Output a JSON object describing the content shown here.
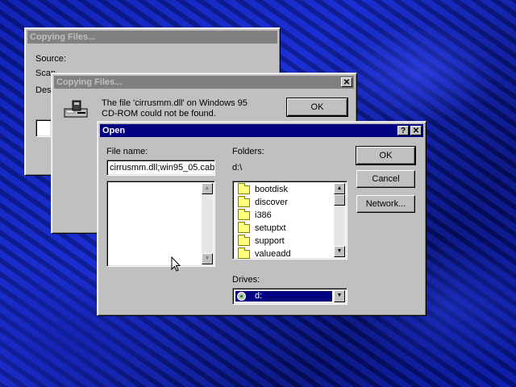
{
  "background_window": {
    "title": "Copying Files...",
    "source_label": "Source:",
    "scanning_label": "Scan",
    "dest_label": "Des"
  },
  "error_dialog": {
    "title": "Copying Files...",
    "message_line1": "The file 'cirrusmm.dll' on Windows 95",
    "message_line2": "CD-ROM could not be found.",
    "ok_label": "OK",
    "close_glyph": "✕"
  },
  "open_dialog": {
    "title": "Open",
    "help_glyph": "?",
    "close_glyph": "✕",
    "file_name_label": "File name:",
    "file_name_value": "cirrusmm.dll;win95_05.cab",
    "folders_label": "Folders:",
    "current_path": "d:\\",
    "folders": [
      "bootdisk",
      "discover",
      "i386",
      "setuptxt",
      "support",
      "valueadd"
    ],
    "drives_label": "Drives:",
    "drive_value": "d:",
    "ok_label": "OK",
    "cancel_label": "Cancel",
    "network_label": "Network..."
  },
  "colors": {
    "active_title": "#000080",
    "inactive_title": "#808080",
    "window_face": "#c0c0c0"
  }
}
